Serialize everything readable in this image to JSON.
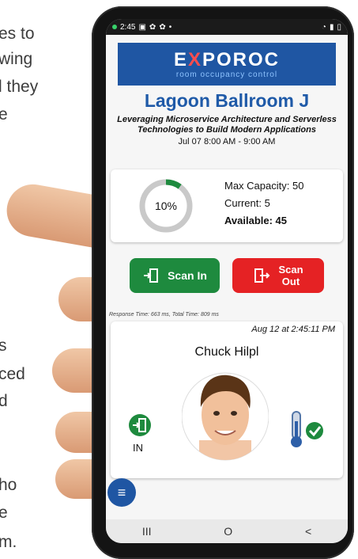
{
  "background_text": {
    "lines": [
      "es to",
      "wing",
      "l they",
      "e",
      "s",
      "ced",
      "d",
      "ho",
      "e",
      "m."
    ]
  },
  "status_bar": {
    "time": "2:45",
    "icons": [
      "notification-icon",
      "photo-icon",
      "settings-icon",
      "settings-icon",
      "dot-icon",
      "wifi-icon",
      "signal-icon",
      "battery-icon"
    ]
  },
  "logo": {
    "brand_prefix": "E",
    "brand_x": "X",
    "brand_suffix": "POROC",
    "tagline": "room occupancy control"
  },
  "room": {
    "name": "Lagoon Ballroom J",
    "session_line1": "Leveraging Microservice Architecture and Serverless",
    "session_line2": "Technologies to Build Modern Applications",
    "time_range": "Jul 07 8:00 AM - 9:00 AM"
  },
  "capacity": {
    "percent_label": "10%",
    "percent_value": 10,
    "max_label": "Max Capacity: 50",
    "current_label": "Current: 5",
    "available_label": "Available: 45"
  },
  "buttons": {
    "scan_in": "Scan In",
    "scan_out_line1": "Scan",
    "scan_out_line2": "Out"
  },
  "response_time": "Response Time: 663 ms, Total Time: 809 ms",
  "scan": {
    "timestamp": "Aug 12 at 2:45:11 PM",
    "person_name": "Chuck Hilpl",
    "direction": "IN"
  },
  "nav": {
    "recents": "III",
    "home": "O",
    "back": "<"
  },
  "colors": {
    "brand_blue": "#1f56a3",
    "title_blue": "#1f5aa8",
    "scan_in_green": "#1e8a3e",
    "scan_out_red": "#e52224",
    "ring_green": "#1e8a3e",
    "ring_grey": "#c9c9c9"
  }
}
